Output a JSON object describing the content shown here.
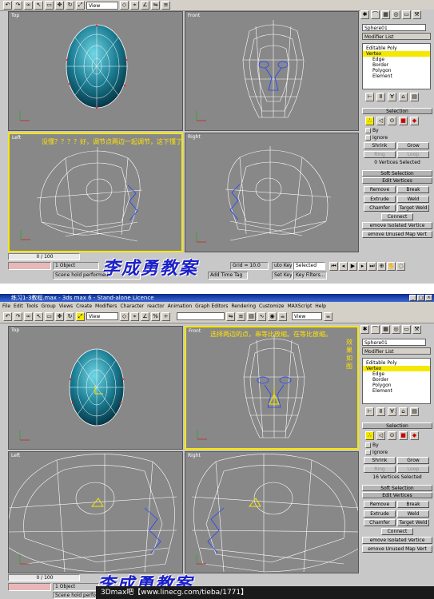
{
  "shot1": {
    "toolbar_view": "View",
    "viewports": {
      "top": "Top",
      "front": "Front",
      "left": "Left",
      "right": "Right"
    },
    "annotation": "没懂？？？？好，调节点两边一起调节，这下懂了吧。",
    "command_panel": {
      "object_name": "Sphere01",
      "modifier_list": "Modifier List",
      "stack": [
        "Editable Poly",
        "Vertex",
        "Edge",
        "Border",
        "Polygon",
        "Element"
      ],
      "selection_head": "Selection",
      "by_label": "By",
      "ignore_label": "Ignore",
      "shrink": "Shrink",
      "grow": "Grow",
      "ring": "Ring",
      "loop": "Loop",
      "selected_count": "0 Vertices Selected",
      "soft_selection_head": "Soft Selection",
      "edit_vertices_head": "Edit Vertices",
      "remove": "Remove",
      "break": "Break",
      "extrude": "Extrude",
      "weld": "Weld",
      "chamfer": "Chamfer",
      "target_weld": "Target Weld",
      "connect": "Connect",
      "remove_isolated": "emove Isolated Vertice",
      "remove_unused": "emove Unused Map Vert"
    },
    "status": {
      "frame": "0 / 100",
      "object_count": "1 Object",
      "message": "Scene hold performed",
      "grid": "Grid = 10.0",
      "autokey": "uto Key",
      "selected": "Selected",
      "setkey": "Set Key",
      "key_filters": "Key Filters...",
      "add_tag": "Add Time Tag"
    },
    "watermark": "李成勇教案"
  },
  "shot2": {
    "title": "练习1-3教程.max - 3ds max 6 - Stand-alone Licence",
    "menu": [
      "File",
      "Edit",
      "Tools",
      "Group",
      "Views",
      "Create",
      "Modifiers",
      "Character",
      "reactor",
      "Animation",
      "Graph Editors",
      "Rendering",
      "Customize",
      "MAXScript",
      "Help"
    ],
    "toolbar_view": "View",
    "viewports": {
      "top": "Top",
      "front": "Front",
      "left": "Left",
      "right": "Right"
    },
    "annotation_line1": "选择两边的点，串等比放缩。在等比放缩。",
    "annotation_side": [
      "效",
      "果",
      "如",
      "图"
    ],
    "command_panel": {
      "object_name": "Sphere01",
      "modifier_list": "Modifier List",
      "stack": [
        "Editable Poly",
        "Vertex",
        "Edge",
        "Border",
        "Polygon",
        "Element"
      ],
      "selection_head": "Selection",
      "by_label": "By",
      "ignore_label": "Ignore",
      "shrink": "Shrink",
      "grow": "Grow",
      "ring": "Ring",
      "loop": "Loop",
      "selected_count": "16 Vertices Selected",
      "soft_selection_head": "Soft Selection",
      "edit_vertices_head": "Edit Vertices",
      "remove": "Remove",
      "break": "Break",
      "extrude": "Extrude",
      "weld": "Weld",
      "chamfer": "Chamfer",
      "target_weld": "Target Weld",
      "connect": "Connect",
      "remove_isolated": "emove Isolated Vertice",
      "remove_unused": "emove Unused Map Vert"
    },
    "status": {
      "frame": "0 / 100",
      "object_count": "1 Object",
      "message": "Scene hold performed"
    },
    "watermark": "李成勇教案",
    "footer": "3Dmax吧【www.linecg.com/tieba/1771】"
  },
  "colors": {
    "selection_yellow": "#f5e800",
    "viewport_gray": "#888888",
    "watermark_blue": "#1c20c8",
    "annotation_yellow": "#ffe400"
  }
}
